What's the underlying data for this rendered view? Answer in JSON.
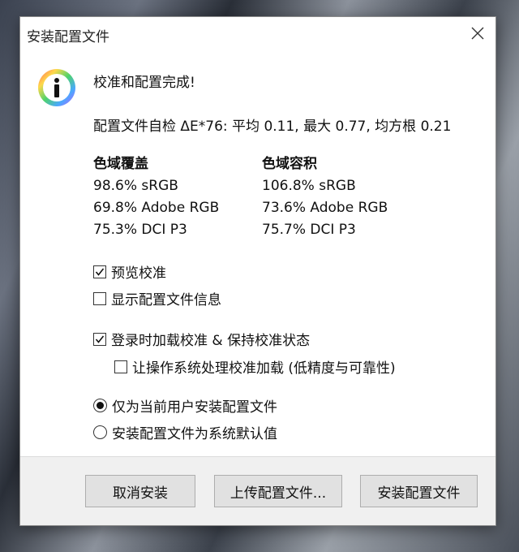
{
  "window": {
    "title": "安装配置文件"
  },
  "heading": "校准和配置完成!",
  "self_check": "配置文件自检 ΔE*76: 平均 0.11, 最大 0.77, 均方根 0.21",
  "gamut_coverage": {
    "title": "色域覆盖",
    "items": [
      "98.6% sRGB",
      "69.8% Adobe RGB",
      "75.3% DCI P3"
    ]
  },
  "gamut_volume": {
    "title": "色域容积",
    "items": [
      "106.8% sRGB",
      "73.6% Adobe RGB",
      "75.7% DCI P3"
    ]
  },
  "options": {
    "preview_calibration": {
      "label": "预览校准",
      "checked": true
    },
    "show_profile_info": {
      "label": "显示配置文件信息",
      "checked": false
    },
    "load_on_login": {
      "label": "登录时加载校准 & 保持校准状态",
      "checked": true
    },
    "let_os_handle": {
      "label": "让操作系统处理校准加载 (低精度与可靠性)",
      "checked": false
    }
  },
  "install_scope": {
    "current_user": {
      "label": "仅为当前用户安装配置文件",
      "selected": true
    },
    "system_default": {
      "label": "安装配置文件为系统默认值",
      "selected": false
    }
  },
  "buttons": {
    "cancel": "取消安装",
    "upload": "上传配置文件...",
    "install": "安装配置文件"
  }
}
